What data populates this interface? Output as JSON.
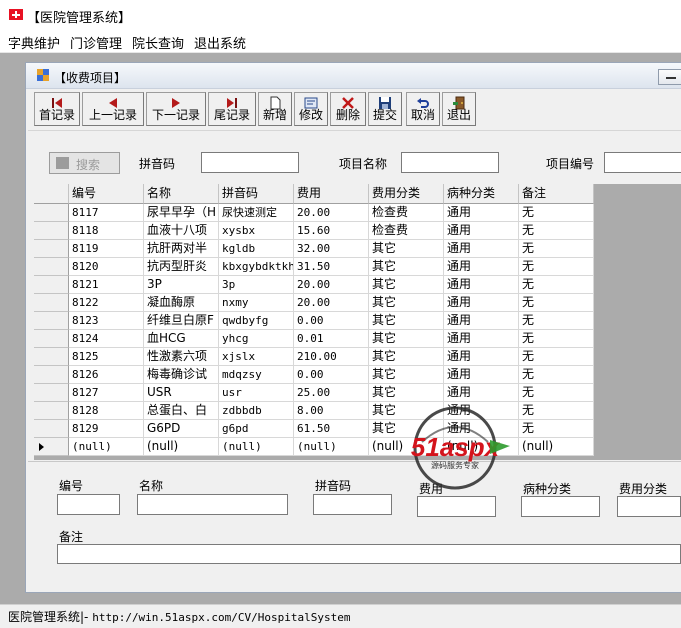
{
  "window": {
    "title": "【医院管理系统】"
  },
  "menu": [
    "字典维护",
    "门诊管理",
    "院长查询",
    "退出系统"
  ],
  "child": {
    "title": "【收费项目】"
  },
  "toolbar": [
    {
      "label": "首记录",
      "icon": "first-record-icon"
    },
    {
      "label": "上一记录",
      "icon": "prev-record-icon"
    },
    {
      "label": "下一记录",
      "icon": "next-record-icon"
    },
    {
      "label": "尾记录",
      "icon": "last-record-icon"
    },
    {
      "label": "新增",
      "icon": "new-doc-icon"
    },
    {
      "label": "修改",
      "icon": "edit-icon"
    },
    {
      "label": "删除",
      "icon": "delete-x-icon"
    },
    {
      "label": "提交",
      "icon": "save-disk-icon"
    },
    {
      "label": "取消",
      "icon": "undo-icon"
    },
    {
      "label": "退出",
      "icon": "exit-door-icon"
    }
  ],
  "search": {
    "button": "搜索",
    "pinyin_label": "拼音码",
    "name_label": "项目名称",
    "code_label": "项目编号"
  },
  "grid": {
    "columns": [
      "编号",
      "名称",
      "拼音码",
      "费用",
      "费用分类",
      "病种分类",
      "备注"
    ],
    "rows": [
      [
        "8117",
        "尿早早孕（H",
        "尿快速测定",
        "20.00",
        "检查费",
        "通用",
        "无"
      ],
      [
        "8118",
        "血液十八项",
        "xysbx",
        "15.60",
        "检查费",
        "通用",
        "无"
      ],
      [
        "8119",
        "抗肝两对半",
        "kgldb",
        "32.00",
        "其它",
        "通用",
        "无"
      ],
      [
        "8120",
        "抗丙型肝炎",
        "kbxgybdktkh",
        "31.50",
        "其它",
        "通用",
        "无"
      ],
      [
        "8121",
        "3P",
        "3p",
        "20.00",
        "其它",
        "通用",
        "无"
      ],
      [
        "8122",
        "凝血酶原",
        "nxmy",
        "20.00",
        "其它",
        "通用",
        "无"
      ],
      [
        "8123",
        "纤维旦白原F",
        "qwdbyfg",
        "0.00",
        "其它",
        "通用",
        "无"
      ],
      [
        "8124",
        "血HCG",
        "yhcg",
        "0.01",
        "其它",
        "通用",
        "无"
      ],
      [
        "8125",
        "性激素六项",
        "xjslx",
        "210.00",
        "其它",
        "通用",
        "无"
      ],
      [
        "8126",
        "梅毒确诊试",
        "mdqzsy",
        "0.00",
        "其它",
        "通用",
        "无"
      ],
      [
        "8127",
        "USR",
        "usr",
        "25.00",
        "其它",
        "通用",
        "无"
      ],
      [
        "8128",
        "总蛋白、白",
        "zdbbdb",
        "8.00",
        "其它",
        "通用",
        "无"
      ],
      [
        "8129",
        "G6PD",
        "g6pd",
        "61.50",
        "其它",
        "通用",
        "无"
      ],
      [
        "(null)",
        "(null)",
        "(null)",
        "(null)",
        "(null)",
        "(null)",
        "(null)"
      ]
    ]
  },
  "form": {
    "code_label": "编号",
    "name_label": "名称",
    "pinyin_label": "拼音码",
    "fee_label": "费用",
    "disease_label": "病种分类",
    "feetype_label": "费用分类",
    "remark_label": "备注"
  },
  "watermark": {
    "brand": "51aspx",
    "sub": "源码服务专家"
  },
  "status": {
    "prefix": "医院管理系统|- ",
    "url": "http://win.51aspx.com/CV/HospitalSystem"
  }
}
